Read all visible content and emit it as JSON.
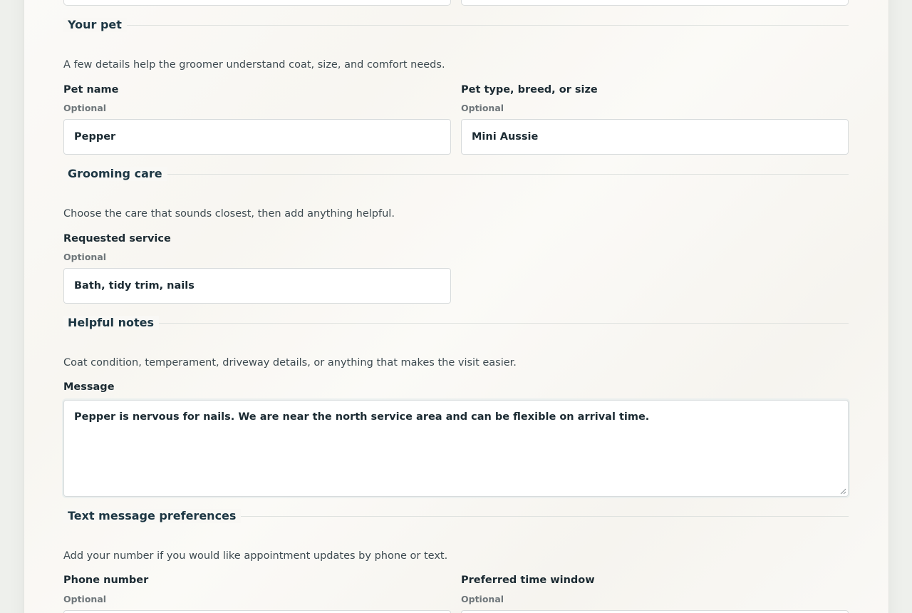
{
  "sections": {
    "pet": {
      "title": "Your pet",
      "description": "A few details help the groomer understand coat, size, and comfort needs.",
      "fields": {
        "pet_name": {
          "label": "Pet name",
          "hint": "Optional",
          "value": "Pepper"
        },
        "pet_type": {
          "label": "Pet type, breed, or size",
          "hint": "Optional",
          "value": "Mini Aussie"
        }
      }
    },
    "grooming": {
      "title": "Grooming care",
      "description": "Choose the care that sounds closest, then add anything helpful.",
      "fields": {
        "service": {
          "label": "Requested service",
          "hint": "Optional",
          "value": "Bath, tidy trim, nails"
        }
      }
    },
    "notes": {
      "title": "Helpful notes",
      "description": "Coat condition, temperament, driveway details, or anything that makes the visit easier.",
      "fields": {
        "message": {
          "label": "Message",
          "value": "Pepper is nervous for nails. We are near the north service area and can be flexible on arrival time."
        }
      }
    },
    "sms": {
      "title": "Text message preferences",
      "description": "Add your number if you would like appointment updates by phone or text.",
      "fields": {
        "phone": {
          "label": "Phone number",
          "hint": "Optional"
        },
        "time_window": {
          "label": "Preferred time window",
          "hint": "Optional"
        }
      }
    }
  },
  "colors": {
    "heading": "#1d3744",
    "text": "#1c2b33",
    "muted": "#6e767a",
    "border": "#d7dbdc"
  },
  "icons": {
    "resize": "resize-grip-icon"
  }
}
